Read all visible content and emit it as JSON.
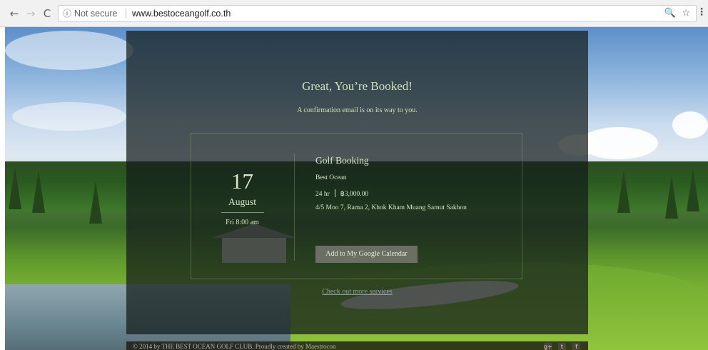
{
  "browser": {
    "back_icon": "←",
    "forward_icon": "→",
    "reload_icon": "C",
    "info_icon": "ⓘ",
    "security_label": "Not secure",
    "url": "www.bestoceangolf.co.th",
    "zoom_icon": "🔍",
    "bookmark_icon": "☆",
    "menu_icon": "⋮"
  },
  "confirmation": {
    "headline": "Great, You’re Booked!",
    "subline": "A confirmation email is on its way to you."
  },
  "booking": {
    "day": "17",
    "month": "August",
    "time": "Fri 8:00 am",
    "service_title": "Golf Booking",
    "provider": "Best Ocean",
    "duration": "24 hr",
    "price": "฿3,000.00",
    "address": "4/5 Moo 7, Rama 2, Khok Kham Muang Samut Sakhon",
    "calendar_button": "Add to My Google Calendar",
    "more_services_link": "Check out more services"
  },
  "footer": {
    "copyright": "© 2014 by THE BEST OCEAN GOLF CLUB. Proudly created by Maestrocon",
    "social_icons": [
      "google-plus-icon",
      "twitter-icon",
      "facebook-icon"
    ],
    "social_glyphs": [
      "g+",
      "t",
      "f"
    ]
  }
}
